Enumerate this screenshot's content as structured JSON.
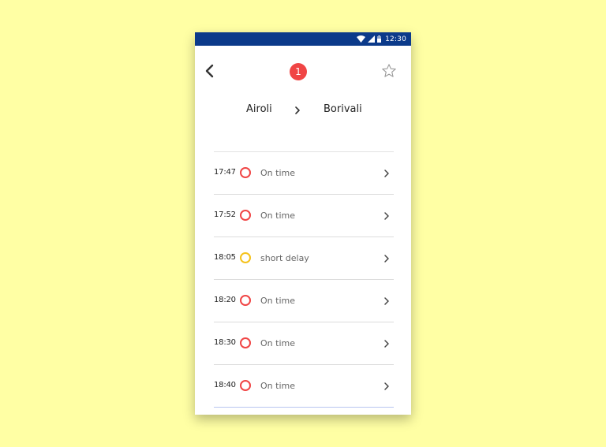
{
  "status_bar": {
    "time": "12:30",
    "icons": [
      "wifi-icon",
      "signal-icon",
      "battery-icon"
    ],
    "background": "#0b3a8a"
  },
  "header": {
    "badge_count": "1",
    "badge_color": "#f04545",
    "back_icon": "chevron-left-icon",
    "favorite_icon": "star-outline-icon"
  },
  "route": {
    "from": "Airoli",
    "to": "Borivali",
    "separator_icon": "chevron-right-icon"
  },
  "trains": [
    {
      "time": "17:47",
      "status": "On time",
      "indicator_color": "#f04545"
    },
    {
      "time": "17:52",
      "status": "On time",
      "indicator_color": "#f04545"
    },
    {
      "time": "18:05",
      "status": "short delay",
      "indicator_color": "#f5c21b"
    },
    {
      "time": "18:20",
      "status": "On time",
      "indicator_color": "#f04545"
    },
    {
      "time": "18:30",
      "status": "On time",
      "indicator_color": "#f04545"
    },
    {
      "time": "18:40",
      "status": "On time",
      "indicator_color": "#f04545"
    }
  ],
  "colors": {
    "page_background": "#ffffa4",
    "accent_red": "#f04545",
    "accent_yellow": "#f5c21b"
  }
}
